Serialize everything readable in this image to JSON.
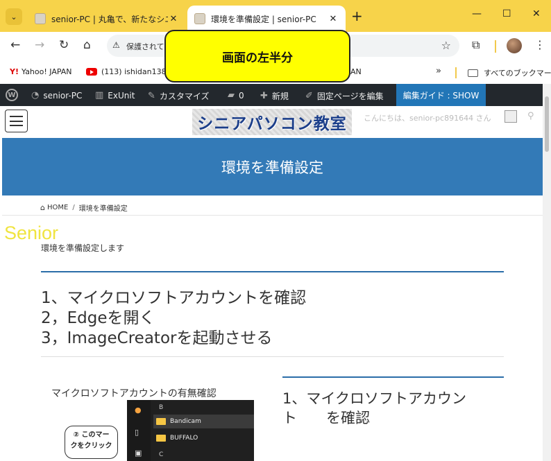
{
  "browser": {
    "tabs": [
      {
        "title": "senior-PC | 丸亀で、新たなシニア(",
        "active": false
      },
      {
        "title": "環境を準備設定 | senior-PC",
        "active": true
      }
    ],
    "new_tab_icon": "plus-icon",
    "window_controls": [
      "minimize",
      "maximize",
      "close"
    ],
    "address": {
      "security_label": "保護されてい",
      "icon": "warning-icon"
    },
    "bookmarks": [
      {
        "label": "Yahoo! JAPAN",
        "icon": "yahoo-icon"
      },
      {
        "label": "(113) ishidan1386",
        "icon": "youtube-icon"
      },
      {
        "label": "AN",
        "icon": ""
      }
    ],
    "bookmarks_overflow": "»",
    "all_bookmarks_label": "すべてのブックマーク"
  },
  "callout": {
    "text": "画面の左半分",
    "color": "#ffff00"
  },
  "admin_bar": {
    "items": [
      {
        "label": "senior-PC",
        "icon": "dashboard-icon"
      },
      {
        "label": "ExUnit",
        "icon": "building-icon"
      },
      {
        "label": "カスタマイズ",
        "icon": "brush-icon"
      },
      {
        "label": "0",
        "icon": "comment-icon"
      },
      {
        "label": "新規",
        "icon": "plus-icon"
      },
      {
        "label": "固定ページを編集",
        "icon": "pencil-icon"
      }
    ],
    "guide_label": "編集ガイド : SHOW",
    "guide_color": "#2276b7"
  },
  "site": {
    "logo_text": "シニアパソコン教室",
    "greeting": "こんにちは、senior-pc891644 さん",
    "page_title": "環境を準備設定",
    "header_color": "#337ab7",
    "breadcrumb": {
      "home": "HOME",
      "current": "環境を準備設定"
    }
  },
  "content": {
    "watermark": "Senior",
    "intro": "環境を準備設定します",
    "steps": [
      "1、マイクロソフトアカウントを確認",
      "2，Edgeを開く",
      "3，ImageCreatorを起動させる"
    ],
    "figure": {
      "caption": "マイクロソフトアカウントの有無確認",
      "bubble_line1": "② このマー",
      "bubble_line2": "クをクリック",
      "explorer": {
        "letter_b": "B",
        "letter_c": "C",
        "folders": [
          "Bandicam",
          "BUFFALO"
        ]
      }
    },
    "section_heading": "1、マイクロソフトアカウン\nト　　を確認"
  }
}
